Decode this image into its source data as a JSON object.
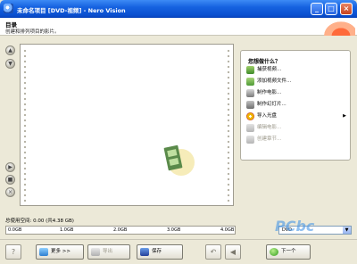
{
  "window": {
    "title": "未命名项目 [DVD-视频] - Nero Vision",
    "controls": [
      "minimize",
      "maximize",
      "close"
    ]
  },
  "header": {
    "title": "目录",
    "subtitle": "创建和排列项目的影片。"
  },
  "tasks": {
    "title": "您想做什么？",
    "items": [
      {
        "label": "捕获视频...",
        "icon": "camera-icon",
        "enabled": true
      },
      {
        "label": "添加视频文件...",
        "icon": "add-file-icon",
        "enabled": true
      },
      {
        "label": "制作电影...",
        "icon": "film-icon",
        "enabled": true
      },
      {
        "label": "制作幻灯片...",
        "icon": "slideshow-icon",
        "enabled": true
      },
      {
        "label": "导入光盘",
        "icon": "disc-icon",
        "enabled": true,
        "submenu": true
      },
      {
        "label": "编辑电影...",
        "icon": "edit-icon",
        "enabled": false
      },
      {
        "label": "创建章节...",
        "icon": "chapter-icon",
        "enabled": false
      }
    ]
  },
  "usage": {
    "label": "总使用空间: 0.00 (共4.38 GB)",
    "ticks": [
      "0.0GB",
      "1.0GB",
      "2.0GB",
      "3.0GB",
      "4.0GB"
    ],
    "disc": "DVD"
  },
  "buttons": {
    "more": "更多 >>",
    "export": "导出",
    "save": "保存",
    "next": "下一个"
  },
  "watermark": "PCbc"
}
